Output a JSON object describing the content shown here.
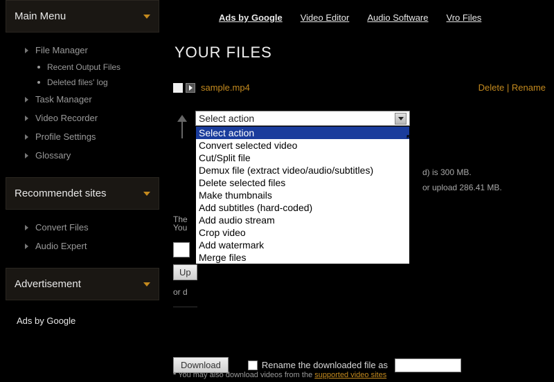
{
  "sidebar": {
    "panels": [
      {
        "title": "Main Menu"
      },
      {
        "title": "Recommendet sites"
      },
      {
        "title": "Advertisement"
      }
    ],
    "menu1": [
      {
        "label": "File Manager"
      },
      {
        "label": "Task Manager"
      },
      {
        "label": "Video Recorder"
      },
      {
        "label": "Profile Settings"
      },
      {
        "label": "Glossary"
      }
    ],
    "menu1_sub": [
      {
        "label": "Recent Output Files"
      },
      {
        "label": "Deleted files' log"
      }
    ],
    "menu2": [
      {
        "label": "Convert Files"
      },
      {
        "label": "Audio Expert"
      }
    ],
    "ads_side": "Ads by Google"
  },
  "topbar": {
    "links": [
      {
        "label": "Ads by Google"
      },
      {
        "label": "Video Editor"
      },
      {
        "label": "Audio Software"
      },
      {
        "label": "Vro Files"
      }
    ]
  },
  "main": {
    "title": "YOUR FILES",
    "file": {
      "name": "sample.mp4",
      "delete": "Delete",
      "sep": " | ",
      "rename": "Rename"
    },
    "select_placeholder": "Select action",
    "options": [
      "Select action",
      "Convert selected video",
      "Cut/Split file",
      "Demux file (extract video/audio/subtitles)",
      "Delete selected files",
      "Make thumbnails",
      "Add subtitles (hard-coded)",
      "Add audio stream",
      "Crop video",
      "Add watermark",
      "Merge files"
    ],
    "limit_text_1": "d) is 300 MB.",
    "limit_text_2": "or upload 286.41 MB.",
    "limit_left_1": "The",
    "limit_left_2": "You",
    "upload_btn": "Up",
    "or_down": "or d",
    "download_btn": "Download",
    "rename_chk": "Rename the downloaded file as",
    "footnote_star": "*",
    "footnote_text": " You may also download videos from the ",
    "footnote_link": "supported video sites"
  }
}
